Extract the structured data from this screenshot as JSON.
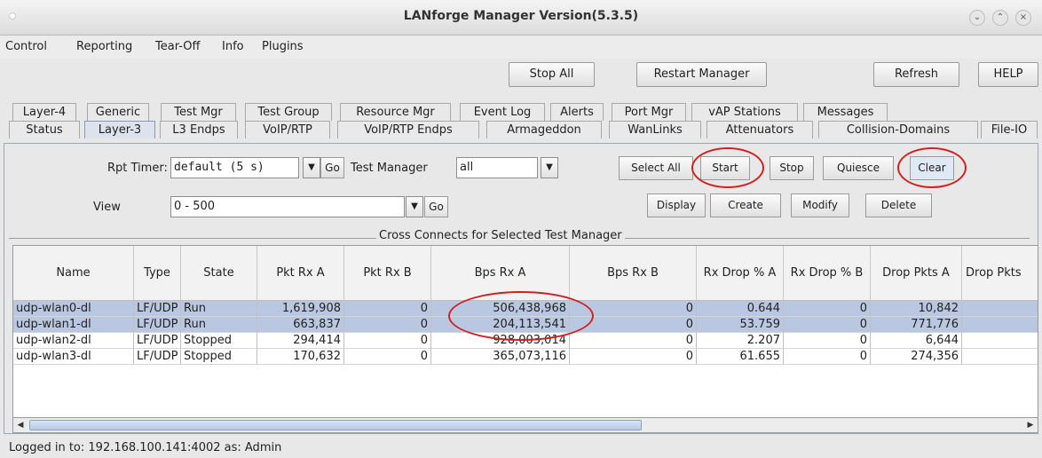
{
  "window": {
    "title": "LANforge Manager   Version(5.3.5)"
  },
  "menu": [
    "Control",
    "Reporting",
    "Tear-Off",
    "Info",
    "Plugins"
  ],
  "toolbar": {
    "stop_all": "Stop All",
    "restart": "Restart Manager",
    "refresh": "Refresh",
    "help": "HELP"
  },
  "tabs_row1": [
    "Layer-4",
    "Generic",
    "Test Mgr",
    "Test Group",
    "Resource Mgr",
    "Event Log",
    "Alerts",
    "Port Mgr",
    "vAP Stations",
    "Messages"
  ],
  "tabs_row2": [
    "Status",
    "Layer-3",
    "L3 Endps",
    "VoIP/RTP",
    "VoIP/RTP Endps",
    "Armageddon",
    "WanLinks",
    "Attenuators",
    "Collision-Domains",
    "File-IO"
  ],
  "controls": {
    "rpt_timer_label": "Rpt Timer:",
    "rpt_timer_value": "default (5 s)",
    "go": "Go",
    "test_manager_label": "Test Manager",
    "test_manager_value": "all",
    "view_label": "View",
    "view_value": "0 - 500",
    "select_all": "Select All",
    "start": "Start",
    "stop": "Stop",
    "quiesce": "Quiesce",
    "clear": "Clear",
    "display": "Display",
    "create": "Create",
    "modify": "Modify",
    "delete": "Delete"
  },
  "table": {
    "title": "Cross Connects for Selected Test Manager",
    "columns": [
      "Name",
      "Type",
      "State",
      "Pkt Rx A",
      "Pkt Rx B",
      "Bps Rx A",
      "Bps Rx B",
      "Rx Drop % A",
      "Rx Drop % B",
      "Drop Pkts A",
      "Drop Pkts"
    ],
    "rows": [
      [
        "udp-wlan0-dl",
        "LF/UDP",
        "Run",
        "1,619,908",
        "0",
        "506,438,968",
        "0",
        "0.644",
        "0",
        "10,842",
        ""
      ],
      [
        "udp-wlan1-dl",
        "LF/UDP",
        "Run",
        "663,837",
        "0",
        "204,113,541",
        "0",
        "53.759",
        "0",
        "771,776",
        ""
      ],
      [
        "udp-wlan2-dl",
        "LF/UDP",
        "Stopped",
        "294,414",
        "0",
        "928,003,014",
        "0",
        "2.207",
        "0",
        "6,644",
        ""
      ],
      [
        "udp-wlan3-dl",
        "LF/UDP",
        "Stopped",
        "170,632",
        "0",
        "365,073,116",
        "0",
        "61.655",
        "0",
        "274,356",
        ""
      ]
    ]
  },
  "status": "Logged in to:  192.168.100.141:4002  as:  Admin",
  "colors": {
    "highlight_ring": "#d21f1f",
    "selected_row": "#b9c8e0",
    "selected_tab": "#dce3ec"
  }
}
